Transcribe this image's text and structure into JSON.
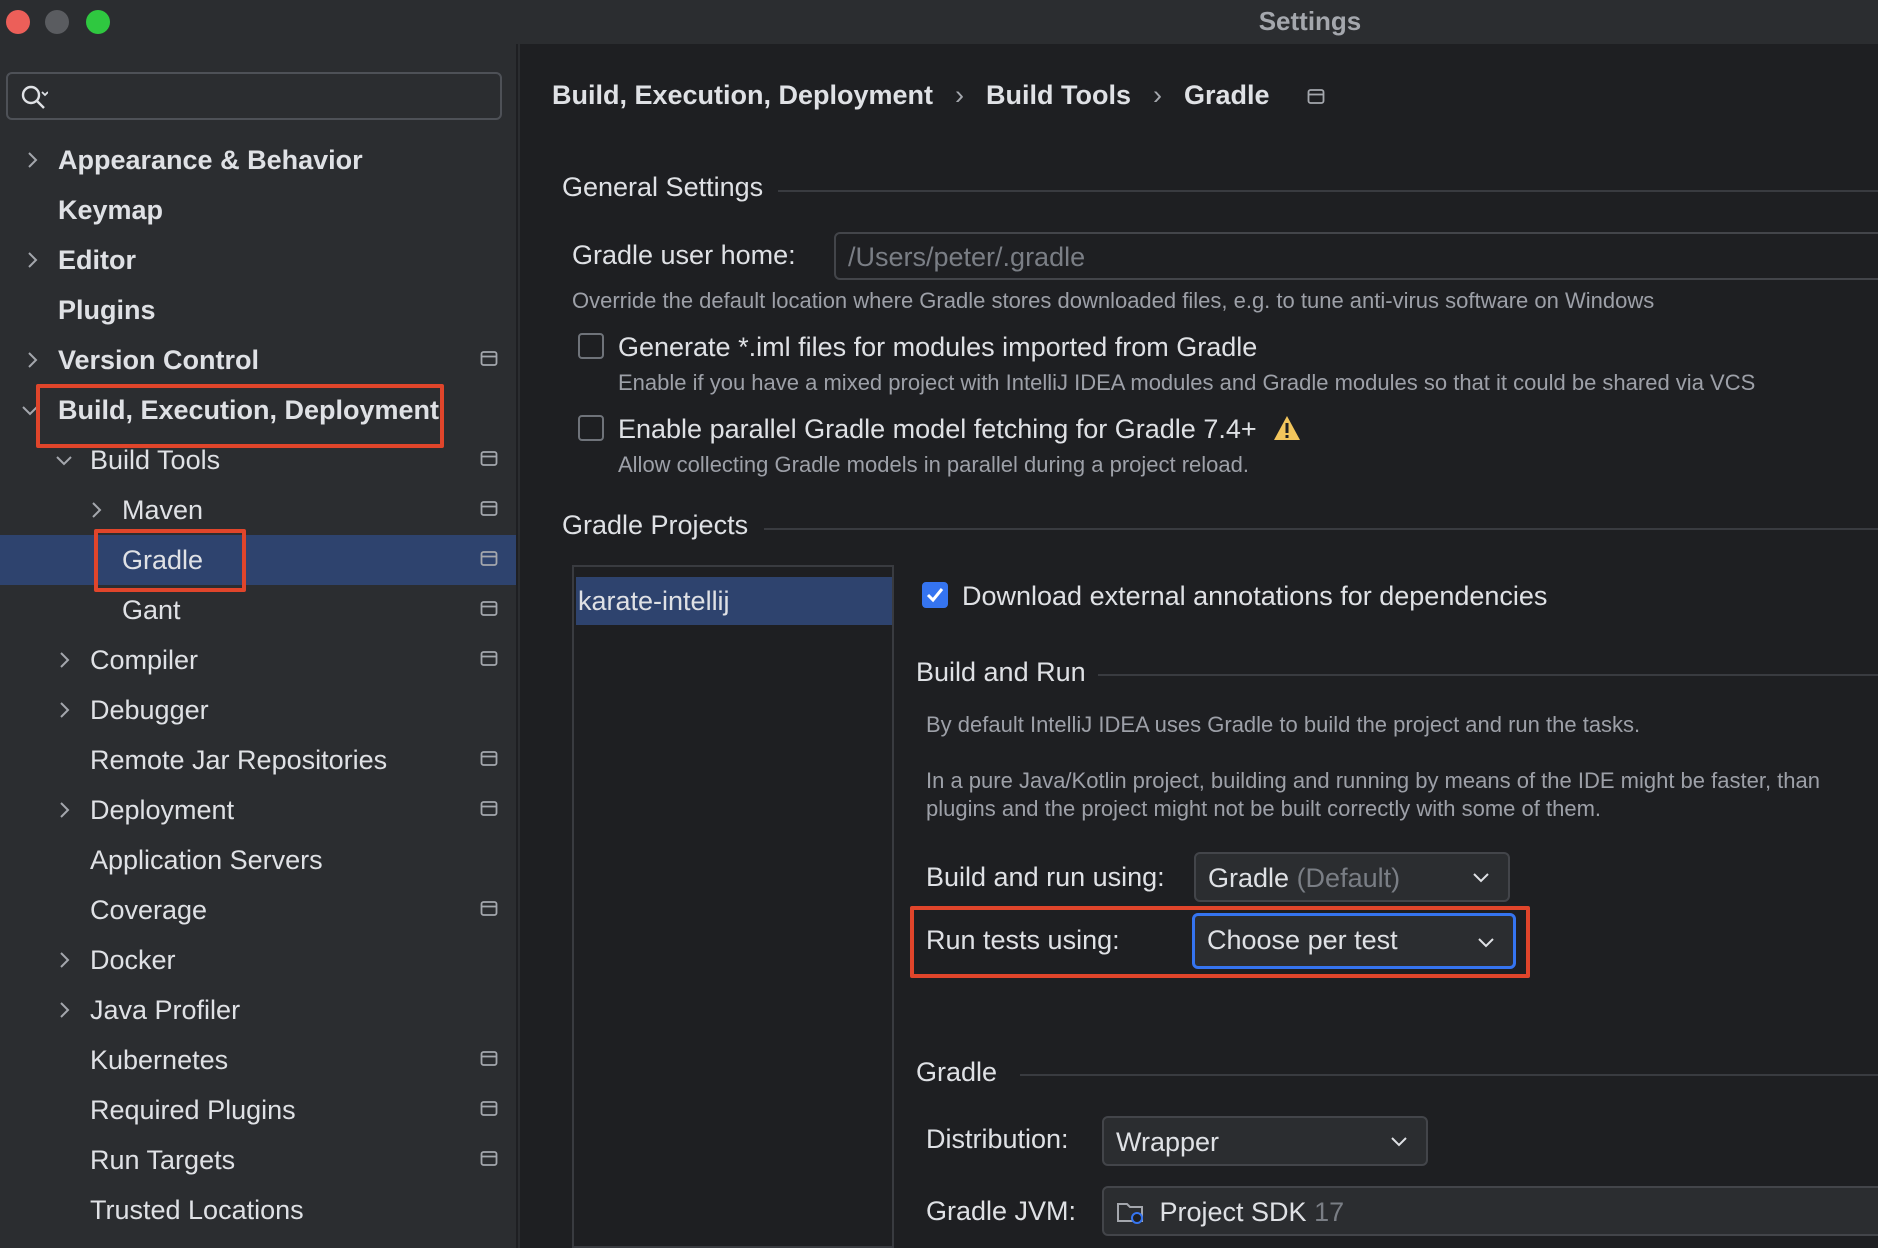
{
  "window": {
    "title": "Settings"
  },
  "search": {
    "placeholder": ""
  },
  "sidebar": {
    "items": [
      {
        "label": "Appearance & Behavior"
      },
      {
        "label": "Keymap"
      },
      {
        "label": "Editor"
      },
      {
        "label": "Plugins"
      },
      {
        "label": "Version Control"
      },
      {
        "label": "Build, Execution, Deployment"
      },
      {
        "label": "Build Tools"
      },
      {
        "label": "Maven"
      },
      {
        "label": "Gradle"
      },
      {
        "label": "Gant"
      },
      {
        "label": "Compiler"
      },
      {
        "label": "Debugger"
      },
      {
        "label": "Remote Jar Repositories"
      },
      {
        "label": "Deployment"
      },
      {
        "label": "Application Servers"
      },
      {
        "label": "Coverage"
      },
      {
        "label": "Docker"
      },
      {
        "label": "Java Profiler"
      },
      {
        "label": "Kubernetes"
      },
      {
        "label": "Required Plugins"
      },
      {
        "label": "Run Targets"
      },
      {
        "label": "Trusted Locations"
      }
    ]
  },
  "breadcrumb": {
    "items": [
      "Build, Execution, Deployment",
      "Build Tools",
      "Gradle"
    ],
    "separator": "›"
  },
  "general": {
    "title": "General Settings",
    "user_home_label": "Gradle user home:",
    "user_home_placeholder": "/Users/peter/.gradle",
    "user_home_hint": "Override the default location where Gradle stores downloaded files, e.g. to tune anti-virus software on Windows",
    "iml_label": "Generate *.iml files for modules imported from Gradle",
    "iml_hint": "Enable if you have a mixed project with IntelliJ IDEA modules and Gradle modules so that it could be shared via VCS",
    "parallel_label": "Enable parallel Gradle model fetching for Gradle 7.4+",
    "parallel_hint": "Allow collecting Gradle models in parallel during a project reload."
  },
  "projects": {
    "title": "Gradle Projects",
    "list": [
      "karate-intellij"
    ],
    "download_annotations_label": "Download external annotations for dependencies"
  },
  "build_and_run": {
    "title": "Build and Run",
    "desc1": "By default IntelliJ IDEA uses Gradle to build the project and run the tasks.",
    "desc2_line1": "In a pure Java/Kotlin project, building and running by means of the IDE might be faster, than",
    "desc2_line2": "plugins and the project might not be built correctly with some of them.",
    "build_run_label": "Build and run using:",
    "build_run_value": "Gradle",
    "build_run_suffix": "(Default)",
    "run_tests_label": "Run tests using:",
    "run_tests_value": "Choose per test"
  },
  "gradle": {
    "title": "Gradle",
    "distribution_label": "Distribution:",
    "distribution_value": "Wrapper",
    "jvm_label": "Gradle JVM:",
    "jvm_value": "Project SDK",
    "jvm_version": "17"
  },
  "colors": {
    "accent": "#3574f0",
    "selection": "#2e436e",
    "highlight": "#e0452b",
    "warning": "#f2c55c"
  }
}
